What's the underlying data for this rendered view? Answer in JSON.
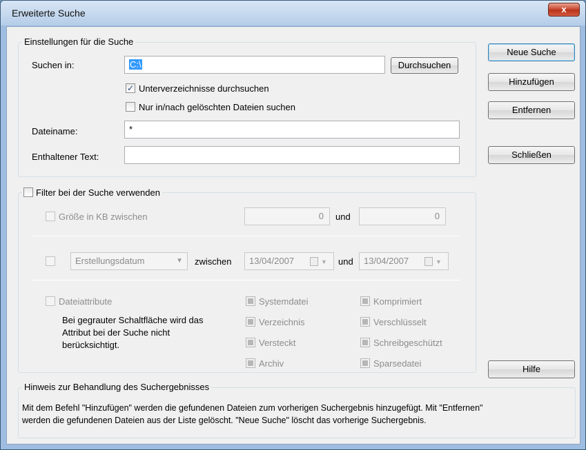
{
  "window": {
    "title": "Erweiterte Suche",
    "close_label": "x"
  },
  "search_settings": {
    "legend": "Einstellungen für die Suche",
    "search_in_label": "Suchen in:",
    "search_in_value": "C:\\",
    "browse_label": "Durchsuchen",
    "subdirs_label": "Unterverzeichnisse durchsuchen",
    "subdirs_checked": true,
    "deleted_only_label": "Nur in/nach gelöschten Dateien suchen",
    "deleted_only_checked": false,
    "filename_label": "Dateiname:",
    "filename_value": "*",
    "contains_text_label": "Enthaltener Text:",
    "contains_text_value": ""
  },
  "filter": {
    "legend": "Filter bei der Suche verwenden",
    "size_label": "Größe in KB zwischen",
    "size_min": "0",
    "and_label": "und",
    "size_max": "0",
    "date_type": "Erstellungsdatum",
    "between_label": "zwischen",
    "date_from": "13/04/2007",
    "date_to": "13/04/2007",
    "attributes_label": "Dateiattribute",
    "attributes_note_1": "Bei gegrauter Schaltfläche wird das",
    "attributes_note_2": "Attribut bei der Suche nicht",
    "attributes_note_3": "berücksichtigt.",
    "attr_system": "Systemdatei",
    "attr_directory": "Verzeichnis",
    "attr_hidden": "Versteckt",
    "attr_archive": "Archiv",
    "attr_compressed": "Komprimiert",
    "attr_encrypted": "Verschlüsselt",
    "attr_readonly": "Schreibgeschützt",
    "attr_sparse": "Sparsedatei"
  },
  "buttons": {
    "new_search": "Neue Suche",
    "add": "Hinzufügen",
    "remove": "Entfernen",
    "close": "Schließen",
    "help": "Hilfe"
  },
  "hint": {
    "legend": "Hinweis zur Behandlung des Suchergebnisses",
    "line1": "Mit dem Befehl \"Hinzufügen\" werden die gefundenen Dateien zum vorherigen Suchergebnis hinzugefügt. Mit \"Entfernen\"",
    "line2": "werden die gefundenen Dateien aus der Liste gelöscht. \"Neue Suche\" löscht das vorherige Suchergebnis."
  },
  "icons": {
    "checkmark": "check-icon",
    "dropdown": "chevron-down-icon",
    "calendar": "calendar-icon"
  }
}
